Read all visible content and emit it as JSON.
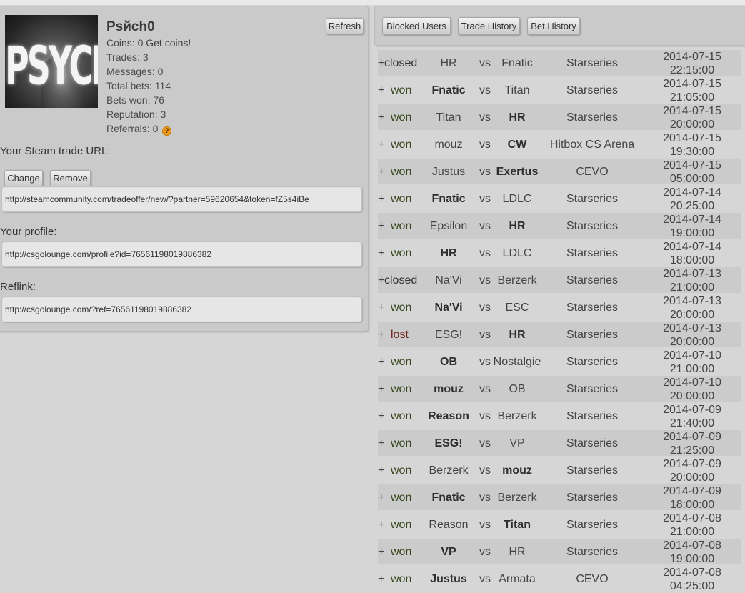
{
  "profile": {
    "username": "Psйch0",
    "avatar_text": "PSYCHO",
    "coins": "Coins: 0",
    "get_coins": "Get coins!",
    "trades": "Trades: 3",
    "messages": "Messages: 0",
    "total_bets": "Total bets: 114",
    "bets_won": "Bets won: 76",
    "reputation": "Reputation: 3",
    "referrals": "Referrals: 0",
    "help_icon_glyph": "?",
    "refresh_label": "Refresh"
  },
  "trade_url": {
    "label": "Your Steam trade URL:",
    "change_label": "Change",
    "remove_label": "Remove",
    "value": "http://steamcommunity.com/tradeoffer/new/?partner=59620654&token=fZ5s4iBe"
  },
  "profile_link": {
    "label": "Your profile:",
    "value": "http://csgolounge.com/profile?id=76561198019886382"
  },
  "reflink": {
    "label": "Reflink:",
    "value": "http://csgolounge.com/?ref=76561198019886382"
  },
  "tabs": {
    "blocked": "Blocked Users",
    "trade_history": "Trade History",
    "bet_history": "Bet History"
  },
  "colors": {
    "won": "#36451b",
    "lost": "#6e2319",
    "panel": "#cacaca",
    "background": "#d6d6d6"
  },
  "bets": [
    {
      "plus": "+",
      "result": "closed",
      "team1": "HR",
      "team1_bold": false,
      "vs": "vs",
      "team2": "Fnatic",
      "team2_bold": false,
      "event": "Starseries",
      "date": "2014-07-15",
      "time": "22:15:00"
    },
    {
      "plus": "+",
      "result": "won",
      "team1": "Fnatic",
      "team1_bold": true,
      "vs": "vs",
      "team2": "Titan",
      "team2_bold": false,
      "event": "Starseries",
      "date": "2014-07-15",
      "time": "21:05:00"
    },
    {
      "plus": "+",
      "result": "won",
      "team1": "Titan",
      "team1_bold": false,
      "vs": "vs",
      "team2": "HR",
      "team2_bold": true,
      "event": "Starseries",
      "date": "2014-07-15",
      "time": "20:00:00"
    },
    {
      "plus": "+",
      "result": "won",
      "team1": "mouz",
      "team1_bold": false,
      "vs": "vs",
      "team2": "CW",
      "team2_bold": true,
      "event": "Hitbox CS Arena",
      "date": "2014-07-15",
      "time": "19:30:00"
    },
    {
      "plus": "+",
      "result": "won",
      "team1": "Justus",
      "team1_bold": false,
      "vs": "vs",
      "team2": "Exertus",
      "team2_bold": true,
      "event": "CEVO",
      "date": "2014-07-15",
      "time": "05:00:00"
    },
    {
      "plus": "+",
      "result": "won",
      "team1": "Fnatic",
      "team1_bold": true,
      "vs": "vs",
      "team2": "LDLC",
      "team2_bold": false,
      "event": "Starseries",
      "date": "2014-07-14",
      "time": "20:25:00"
    },
    {
      "plus": "+",
      "result": "won",
      "team1": "Epsilon",
      "team1_bold": false,
      "vs": "vs",
      "team2": "HR",
      "team2_bold": true,
      "event": "Starseries",
      "date": "2014-07-14",
      "time": "19:00:00"
    },
    {
      "plus": "+",
      "result": "won",
      "team1": "HR",
      "team1_bold": true,
      "vs": "vs",
      "team2": "LDLC",
      "team2_bold": false,
      "event": "Starseries",
      "date": "2014-07-14",
      "time": "18:00:00"
    },
    {
      "plus": "+",
      "result": "closed",
      "team1": "Na'Vi",
      "team1_bold": false,
      "vs": "vs",
      "team2": "Berzerk",
      "team2_bold": false,
      "event": "Starseries",
      "date": "2014-07-13",
      "time": "21:00:00"
    },
    {
      "plus": "+",
      "result": "won",
      "team1": "Na'Vi",
      "team1_bold": true,
      "vs": "vs",
      "team2": "ESC",
      "team2_bold": false,
      "event": "Starseries",
      "date": "2014-07-13",
      "time": "20:00:00"
    },
    {
      "plus": "+",
      "result": "lost",
      "team1": "ESG!",
      "team1_bold": false,
      "vs": "vs",
      "team2": "HR",
      "team2_bold": true,
      "event": "Starseries",
      "date": "2014-07-13",
      "time": "20:00:00"
    },
    {
      "plus": "+",
      "result": "won",
      "team1": "OB",
      "team1_bold": true,
      "vs": "vs",
      "team2": "Nostalgie",
      "team2_bold": false,
      "event": "Starseries",
      "date": "2014-07-10",
      "time": "21:00:00"
    },
    {
      "plus": "+",
      "result": "won",
      "team1": "mouz",
      "team1_bold": true,
      "vs": "vs",
      "team2": "OB",
      "team2_bold": false,
      "event": "Starseries",
      "date": "2014-07-10",
      "time": "20:00:00"
    },
    {
      "plus": "+",
      "result": "won",
      "team1": "Reason",
      "team1_bold": true,
      "vs": "vs",
      "team2": "Berzerk",
      "team2_bold": false,
      "event": "Starseries",
      "date": "2014-07-09",
      "time": "21:40:00"
    },
    {
      "plus": "+",
      "result": "won",
      "team1": "ESG!",
      "team1_bold": true,
      "vs": "vs",
      "team2": "VP",
      "team2_bold": false,
      "event": "Starseries",
      "date": "2014-07-09",
      "time": "21:25:00"
    },
    {
      "plus": "+",
      "result": "won",
      "team1": "Berzerk",
      "team1_bold": false,
      "vs": "vs",
      "team2": "mouz",
      "team2_bold": true,
      "event": "Starseries",
      "date": "2014-07-09",
      "time": "20:00:00"
    },
    {
      "plus": "+",
      "result": "won",
      "team1": "Fnatic",
      "team1_bold": true,
      "vs": "vs",
      "team2": "Berzerk",
      "team2_bold": false,
      "event": "Starseries",
      "date": "2014-07-09",
      "time": "18:00:00"
    },
    {
      "plus": "+",
      "result": "won",
      "team1": "Reason",
      "team1_bold": false,
      "vs": "vs",
      "team2": "Titan",
      "team2_bold": true,
      "event": "Starseries",
      "date": "2014-07-08",
      "time": "21:00:00"
    },
    {
      "plus": "+",
      "result": "won",
      "team1": "VP",
      "team1_bold": true,
      "vs": "vs",
      "team2": "HR",
      "team2_bold": false,
      "event": "Starseries",
      "date": "2014-07-08",
      "time": "19:00:00"
    },
    {
      "plus": "+",
      "result": "won",
      "team1": "Justus",
      "team1_bold": true,
      "vs": "vs",
      "team2": "Armata",
      "team2_bold": false,
      "event": "CEVO",
      "date": "2014-07-08",
      "time": "04:25:00"
    }
  ]
}
